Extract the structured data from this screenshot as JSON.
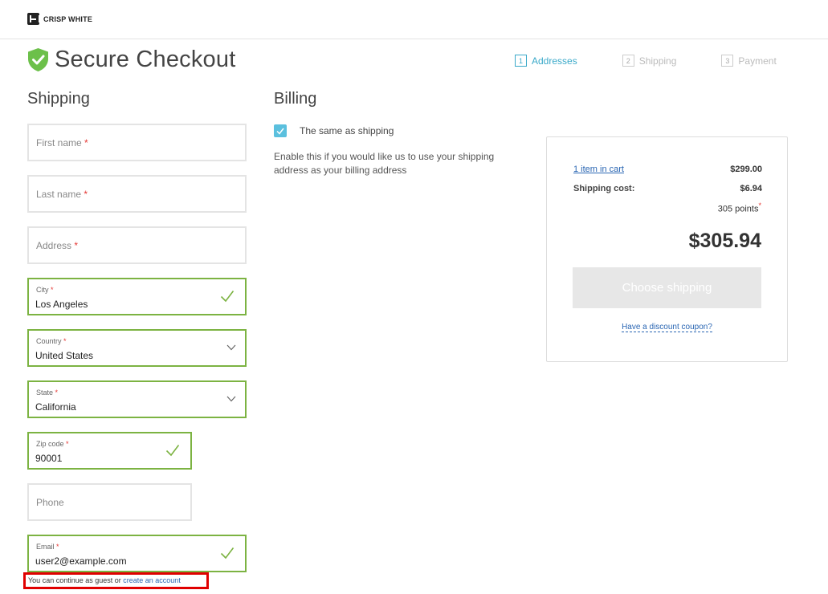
{
  "brand": {
    "name": "CRISP WHITE"
  },
  "page": {
    "title": "Secure Checkout"
  },
  "steps": [
    {
      "num": "1",
      "label": "Addresses",
      "active": true
    },
    {
      "num": "2",
      "label": "Shipping",
      "active": false
    },
    {
      "num": "3",
      "label": "Payment",
      "active": false
    }
  ],
  "shipping": {
    "heading": "Shipping",
    "first_name": {
      "placeholder": "First name"
    },
    "last_name": {
      "placeholder": "Last name"
    },
    "address": {
      "placeholder": "Address"
    },
    "city": {
      "label": "City",
      "value": "Los Angeles"
    },
    "country": {
      "label": "Country",
      "value": "United States"
    },
    "state": {
      "label": "State",
      "value": "California"
    },
    "zip": {
      "label": "Zip code",
      "value": "90001"
    },
    "phone": {
      "placeholder": "Phone"
    },
    "email": {
      "label": "Email",
      "value": "user2@example.com"
    },
    "required_mark": "*",
    "guest_text": "You can continue as guest or ",
    "create_account_link": "create an account"
  },
  "billing": {
    "heading": "Billing",
    "same_as_shipping_label": "The same as shipping",
    "same_as_shipping_checked": true,
    "help_text": "Enable this if you would like us to use your shipping address as your billing address"
  },
  "summary": {
    "cart_link": "1 item in cart",
    "cart_amount": "$299.00",
    "shipping_label": "Shipping cost:",
    "shipping_amount": "$6.94",
    "points": "305 points",
    "points_mark": "*",
    "total": "$305.94",
    "choose_button": "Choose shipping",
    "coupon_link": "Have a discount coupon?"
  },
  "colors": {
    "valid": "#7cb342",
    "accent": "#3aa9c9",
    "link": "#2a66b3",
    "required": "#e53935",
    "shield": "#6cc04a"
  }
}
